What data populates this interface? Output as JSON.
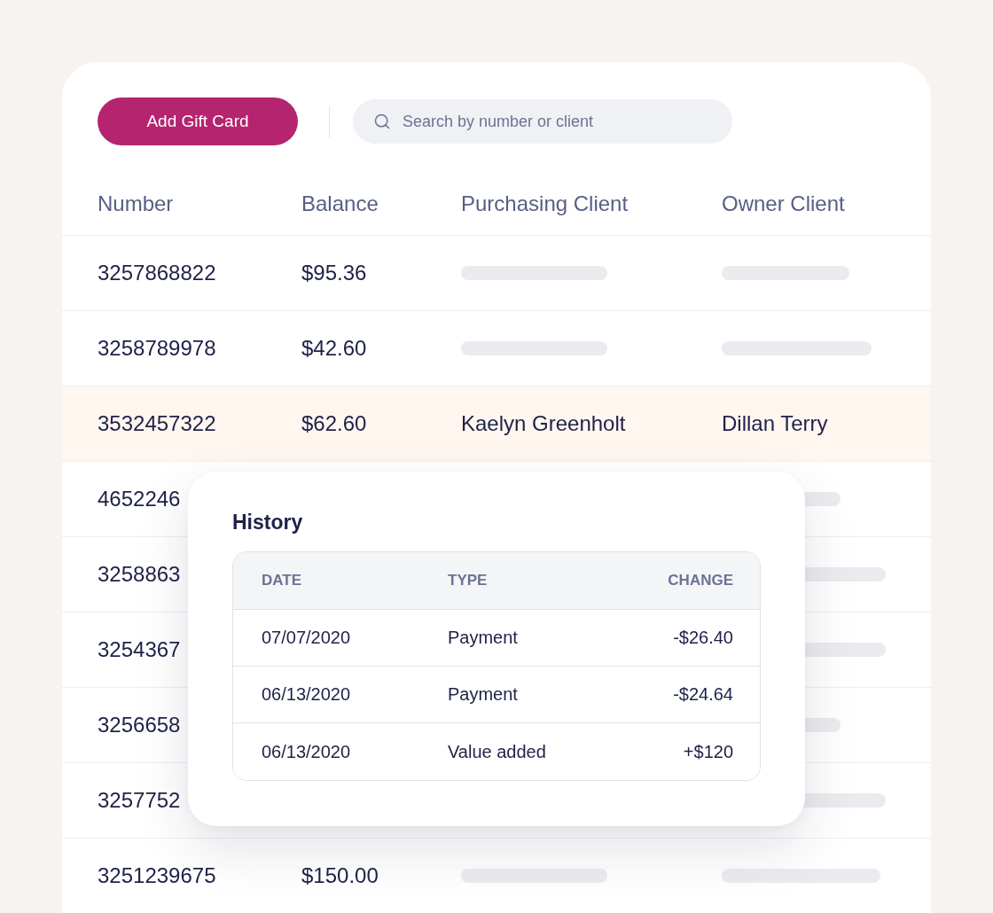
{
  "toolbar": {
    "add_button": "Add Gift Card",
    "search": {
      "placeholder": "Search by number or client"
    }
  },
  "table": {
    "columns": [
      "Number",
      "Balance",
      "Purchasing Client",
      "Owner Client"
    ],
    "rows": [
      {
        "number": "3257868822",
        "balance": "$95.36",
        "purchasing_client": {
          "kind": "skeleton"
        },
        "owner_client": {
          "kind": "skeleton"
        },
        "selected": false
      },
      {
        "number": "3258789978",
        "balance": "$42.60",
        "purchasing_client": {
          "kind": "skeleton"
        },
        "owner_client": {
          "kind": "skeleton"
        },
        "selected": false
      },
      {
        "number": "3532457322",
        "balance": "$62.60",
        "purchasing_client": {
          "kind": "text",
          "text": "Kaelyn Greenholt"
        },
        "owner_client": {
          "kind": "text",
          "text": "Dillan Terry"
        },
        "selected": true
      },
      {
        "number": "4652246",
        "owner_client": {
          "kind": "skeleton"
        },
        "selected": false
      },
      {
        "number": "3258863",
        "owner_client": {
          "kind": "skeleton"
        },
        "selected": false
      },
      {
        "number": "3254367",
        "owner_client": {
          "kind": "skeleton"
        },
        "selected": false
      },
      {
        "number": "3256658",
        "owner_client": {
          "kind": "skeleton"
        },
        "selected": false
      },
      {
        "number": "3257752",
        "owner_client": {
          "kind": "skeleton"
        },
        "selected": false
      },
      {
        "number": "3251239675",
        "balance": "$150.00",
        "purchasing_client": {
          "kind": "skeleton"
        },
        "owner_client": {
          "kind": "skeleton"
        },
        "selected": false
      }
    ]
  },
  "history": {
    "title": "History",
    "columns": [
      "DATE",
      "TYPE",
      "CHANGE"
    ],
    "rows": [
      {
        "date": "07/07/2020",
        "type": "Payment",
        "change": "-$26.40"
      },
      {
        "date": "06/13/2020",
        "type": "Payment",
        "change": "-$24.64"
      },
      {
        "date": "06/13/2020",
        "type": "Value added",
        "change": "+$120"
      }
    ]
  }
}
